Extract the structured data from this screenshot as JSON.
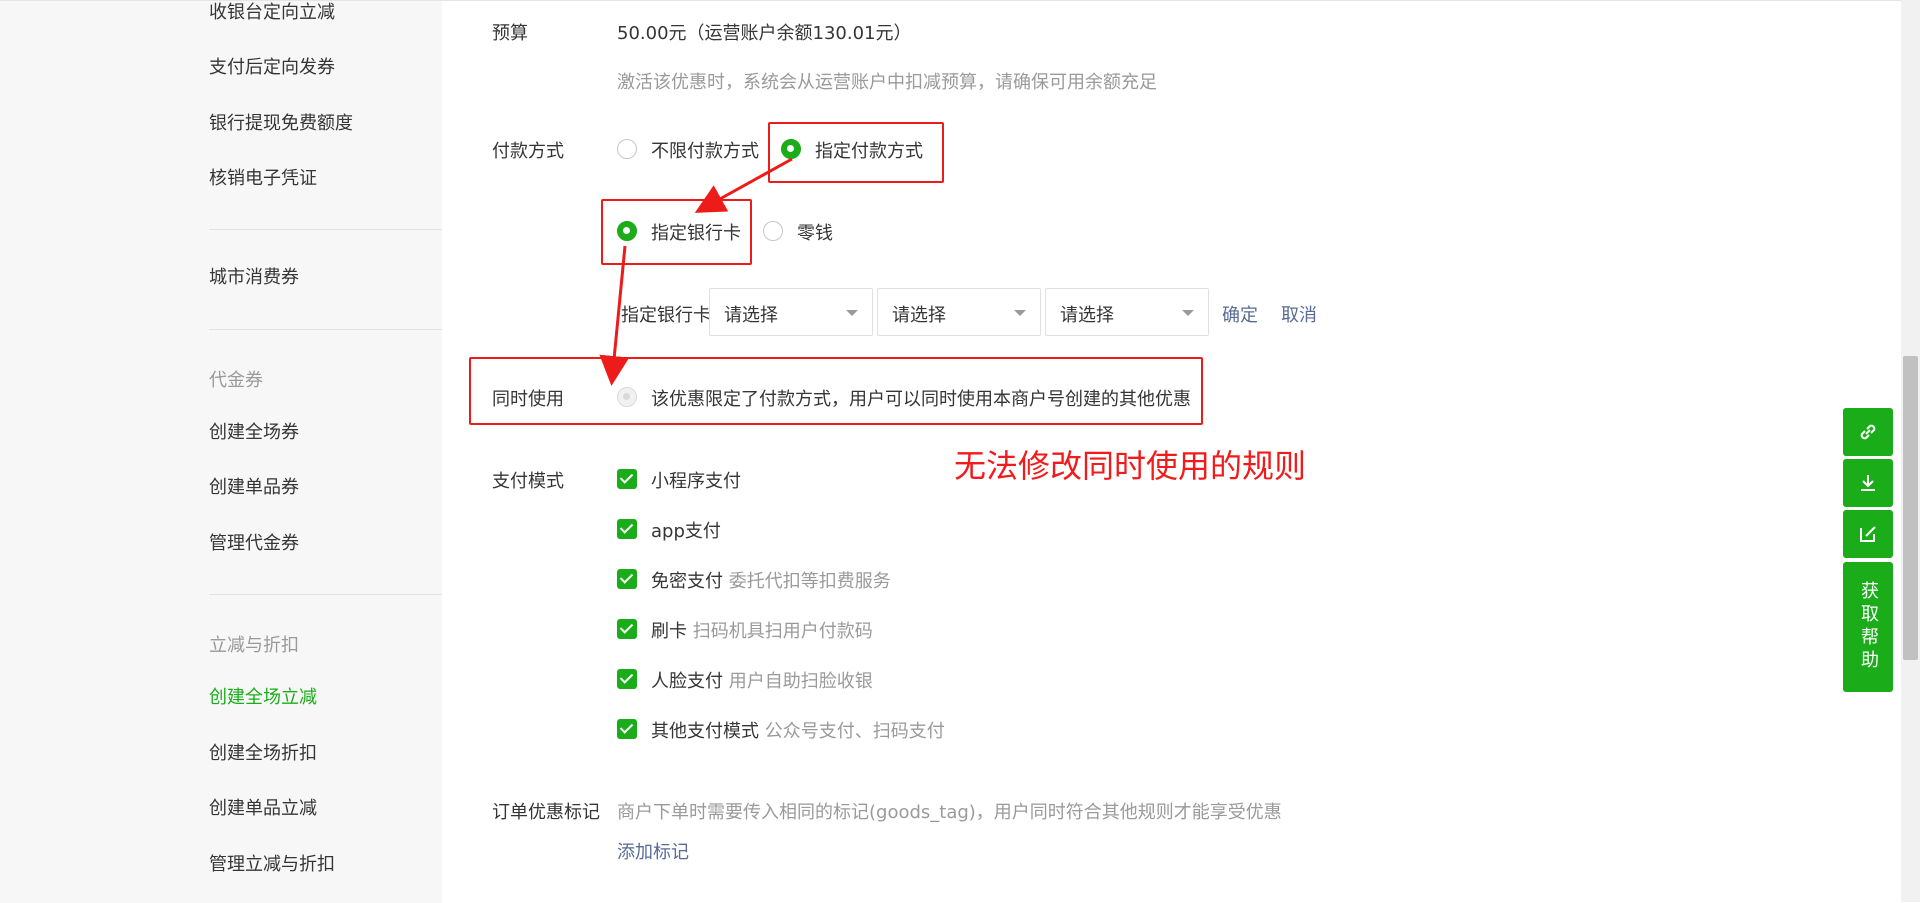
{
  "sidebar": {
    "items": [
      {
        "label": "收银台定向立减"
      },
      {
        "label": "支付后定向发券"
      },
      {
        "label": "银行提现免费额度"
      },
      {
        "label": "核销电子凭证"
      },
      {
        "label": "城市消费券"
      },
      {
        "label": "创建全场券"
      },
      {
        "label": "创建单品券"
      },
      {
        "label": "管理代金券"
      },
      {
        "label": "创建全场立减"
      },
      {
        "label": "创建全场折扣"
      },
      {
        "label": "创建单品立减"
      },
      {
        "label": "管理立减与折扣"
      }
    ],
    "groups": {
      "voucher": "代金券",
      "discount": "立减与折扣"
    },
    "active_item": "创建全场立减"
  },
  "form": {
    "budget": {
      "label": "预算",
      "value": "50.00元（运营账户余额130.01元）",
      "hint": "激活该优惠时，系统会从运营账户中扣减预算，请确保可用余额充足"
    },
    "payment_method": {
      "label": "付款方式",
      "options": [
        "不限付款方式",
        "指定付款方式"
      ],
      "selected": "指定付款方式",
      "sub_options": [
        "指定银行卡",
        "零钱"
      ],
      "sub_selected": "指定银行卡",
      "bank_card_label": "指定银行卡",
      "selects": [
        "请选择",
        "请选择",
        "请选择"
      ],
      "confirm": "确定",
      "cancel": "取消"
    },
    "concurrent": {
      "label": "同时使用",
      "text": "该优惠限定了付款方式，用户可以同时使用本商户号创建的其他优惠"
    },
    "pay_mode": {
      "label": "支付模式",
      "items": [
        {
          "label": "小程序支付",
          "hint": ""
        },
        {
          "label": "app支付",
          "hint": ""
        },
        {
          "label": "免密支付",
          "hint": "委托代扣等扣费服务"
        },
        {
          "label": "刷卡",
          "hint": "扫码机具扫用户付款码"
        },
        {
          "label": "人脸支付",
          "hint": "用户自助扫脸收银"
        },
        {
          "label": "其他支付模式",
          "hint": "公众号支付、扫码支付"
        }
      ]
    },
    "order_tag": {
      "label": "订单优惠标记",
      "hint": "商户下单时需要传入相同的标记(goods_tag)，用户同时符合其他规则才能享受优惠",
      "add_link": "添加标记"
    }
  },
  "annotation": "无法修改同时使用的规则",
  "float_tools": {
    "icons": [
      "link-icon",
      "download-icon",
      "edit-icon"
    ],
    "help": "获取帮助"
  },
  "colors": {
    "accent": "#1aad19",
    "annotation": "#ee1b1b",
    "link": "#576b95"
  }
}
